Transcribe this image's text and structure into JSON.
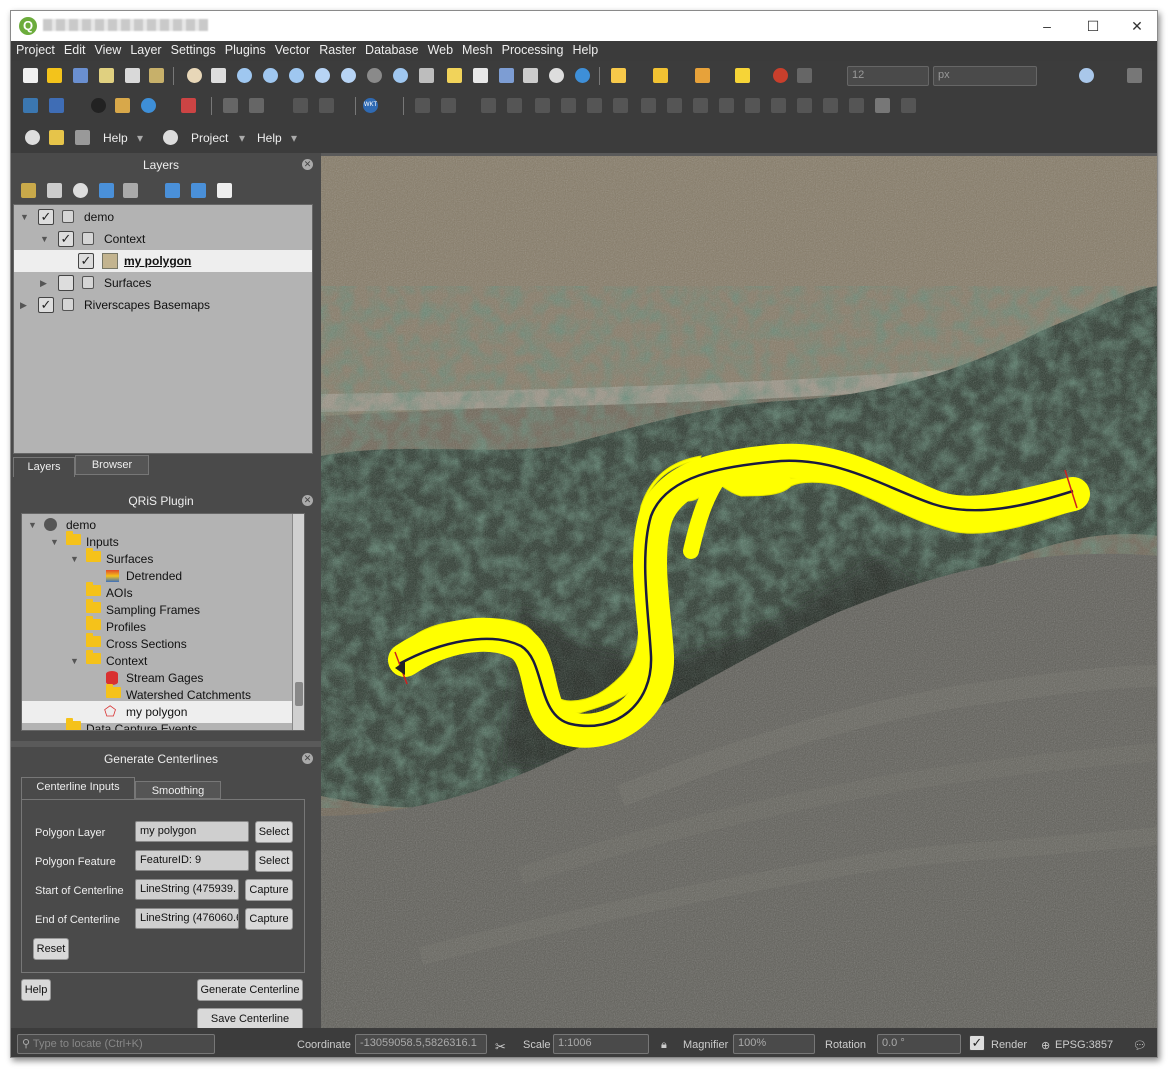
{
  "menubar": {
    "items": [
      "Project",
      "Edit",
      "View",
      "Layer",
      "Settings",
      "Plugins",
      "Vector",
      "Raster",
      "Database",
      "Web",
      "Mesh",
      "Processing",
      "Help"
    ]
  },
  "toolbar": {
    "font_size": "12",
    "font_unit": "px",
    "help_label": "Help",
    "project_label": "Project",
    "help2_label": "Help",
    "wkt_label": "WKT"
  },
  "layers_panel": {
    "title": "Layers",
    "tree": [
      {
        "label": "demo",
        "checked": true
      },
      {
        "label": "Context",
        "checked": true
      },
      {
        "label": "my polygon",
        "checked": true,
        "selected": true
      },
      {
        "label": "Surfaces",
        "checked": false
      },
      {
        "label": "Riverscapes Basemaps",
        "checked": true
      }
    ],
    "tabs": [
      "Layers",
      "Browser"
    ]
  },
  "qris_panel": {
    "title": "QRiS Plugin",
    "tree": [
      "demo",
      "Inputs",
      "Surfaces",
      "Detrended",
      "AOIs",
      "Sampling Frames",
      "Profiles",
      "Cross Sections",
      "Context",
      "Stream Gages",
      "Watershed Catchments",
      "my polygon",
      "Data Capture Events"
    ]
  },
  "centerline_panel": {
    "title": "Generate Centerlines",
    "tabs": [
      "Centerline Inputs",
      "Smoothing"
    ],
    "polygon_layer_label": "Polygon Layer",
    "polygon_layer_value": "my polygon",
    "polygon_feature_label": "Polygon Feature",
    "polygon_feature_value": "FeatureID: 9",
    "start_label": "Start of Centerline",
    "start_value": "LineString (475939.",
    "end_label": "End of Centerline",
    "end_value": "LineString (476060.6",
    "select_label": "Select",
    "capture_label": "Capture",
    "reset_label": "Reset",
    "help_label": "Help",
    "generate_label": "Generate Centerline",
    "save_label": "Save Centerline"
  },
  "statusbar": {
    "locate_placeholder": "Type to locate (Ctrl+K)",
    "coordinate_label": "Coordinate",
    "coordinate_value": "-13059058.5,5826316.1",
    "scale_label": "Scale",
    "scale_value": "1:1006",
    "magnifier_label": "Magnifier",
    "magnifier_value": "100%",
    "rotation_label": "Rotation",
    "rotation_value": "0.0 °",
    "render_label": "Render",
    "crs_label": "EPSG:3857"
  },
  "colors": {
    "polygon_fill": "#ffff00",
    "centerline": "#1a1a40",
    "endpoint_marker": "#d02020"
  }
}
